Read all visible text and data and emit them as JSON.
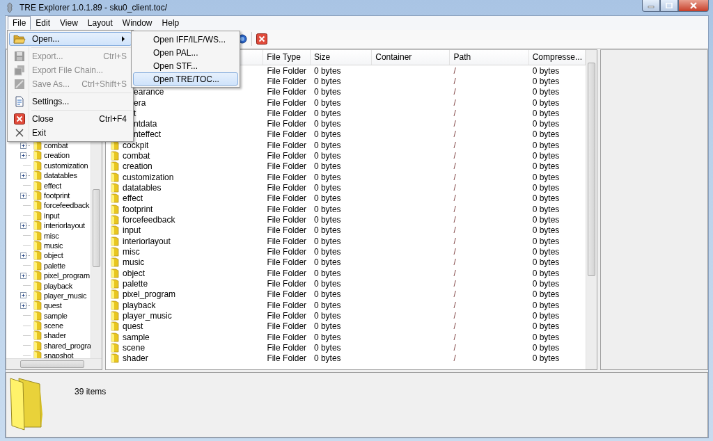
{
  "window": {
    "title": "TRE Explorer 1.0.1.89 - sku0_client.toc/"
  },
  "menubar": [
    {
      "label": "File",
      "selected": true
    },
    {
      "label": "Edit",
      "selected": false
    },
    {
      "label": "View",
      "selected": false
    },
    {
      "label": "Layout",
      "selected": false
    },
    {
      "label": "Window",
      "selected": false
    },
    {
      "label": "Help",
      "selected": false
    }
  ],
  "file_menu": [
    {
      "kind": "item",
      "label": "Open...",
      "selected": true,
      "disabled": false,
      "submenu": true
    },
    {
      "kind": "separator"
    },
    {
      "kind": "item",
      "label": "Export...",
      "shortcut": "Ctrl+S",
      "selected": false,
      "disabled": true
    },
    {
      "kind": "item",
      "label": "Export File Chain...",
      "selected": false,
      "disabled": true
    },
    {
      "kind": "item",
      "label": "Save As...",
      "shortcut": "Ctrl+Shift+S",
      "selected": false,
      "disabled": true
    },
    {
      "kind": "separator"
    },
    {
      "kind": "item",
      "label": "Settings...",
      "selected": false,
      "disabled": false
    },
    {
      "kind": "separator"
    },
    {
      "kind": "item",
      "label": "Close",
      "shortcut": "Ctrl+F4",
      "selected": false,
      "disabled": false
    },
    {
      "kind": "item",
      "label": "Exit",
      "selected": false,
      "disabled": false
    }
  ],
  "open_submenu": [
    {
      "label": "Open IFF/ILF/WS...",
      "selected": false
    },
    {
      "label": "Open PAL...",
      "selected": false
    },
    {
      "label": "Open STF...",
      "selected": false
    },
    {
      "label": "Open TRE/TOC...",
      "selected": true
    }
  ],
  "tree": [
    {
      "name": "combat",
      "expandable": true
    },
    {
      "name": "creation",
      "expandable": true
    },
    {
      "name": "customization",
      "expandable": false
    },
    {
      "name": "datatables",
      "expandable": true
    },
    {
      "name": "effect",
      "expandable": false
    },
    {
      "name": "footprint",
      "expandable": true
    },
    {
      "name": "forcefeedback",
      "expandable": false
    },
    {
      "name": "input",
      "expandable": false
    },
    {
      "name": "interiorlayout",
      "expandable": true
    },
    {
      "name": "misc",
      "expandable": false
    },
    {
      "name": "music",
      "expandable": false
    },
    {
      "name": "object",
      "expandable": true
    },
    {
      "name": "palette",
      "expandable": false
    },
    {
      "name": "pixel_program",
      "expandable": true
    },
    {
      "name": "playback",
      "expandable": false
    },
    {
      "name": "player_music",
      "expandable": true
    },
    {
      "name": "quest",
      "expandable": true
    },
    {
      "name": "sample",
      "expandable": false
    },
    {
      "name": "scene",
      "expandable": false
    },
    {
      "name": "shader",
      "expandable": false
    },
    {
      "name": "shared_progra",
      "expandable": false
    },
    {
      "name": "snapshot",
      "expandable": false
    }
  ],
  "table": {
    "columns": [
      "File Type",
      "Size",
      "Container",
      "Path",
      "Compresse..."
    ],
    "rows": [
      {
        "file_type": "File Folder",
        "size": "0 bytes",
        "path": "/",
        "compressed": "0 bytes"
      },
      {
        "file_type": "File Folder",
        "size": "0 bytes",
        "path": "/",
        "compressed": "0 bytes"
      },
      {
        "name": "earance",
        "partly_covered": true,
        "file_type": "File Folder",
        "size": "0 bytes",
        "path": "/",
        "compressed": "0 bytes"
      },
      {
        "name": "era",
        "partly_covered": true,
        "file_type": "File Folder",
        "size": "0 bytes",
        "path": "/",
        "compressed": "0 bytes"
      },
      {
        "name": "t",
        "partly_covered": true,
        "file_type": "File Folder",
        "size": "0 bytes",
        "path": "/",
        "compressed": "0 bytes"
      },
      {
        "name": "ntdata",
        "partly_covered": true,
        "file_type": "File Folder",
        "size": "0 bytes",
        "path": "/",
        "compressed": "0 bytes"
      },
      {
        "name": "nteffect",
        "partly_covered": true,
        "file_type": "File Folder",
        "size": "0 bytes",
        "path": "/",
        "compressed": "0 bytes"
      },
      {
        "name": "cockpit",
        "file_type": "File Folder",
        "size": "0 bytes",
        "path": "/",
        "compressed": "0 bytes"
      },
      {
        "name": "combat",
        "file_type": "File Folder",
        "size": "0 bytes",
        "path": "/",
        "compressed": "0 bytes"
      },
      {
        "name": "creation",
        "file_type": "File Folder",
        "size": "0 bytes",
        "path": "/",
        "compressed": "0 bytes"
      },
      {
        "name": "customization",
        "file_type": "File Folder",
        "size": "0 bytes",
        "path": "/",
        "compressed": "0 bytes"
      },
      {
        "name": "datatables",
        "file_type": "File Folder",
        "size": "0 bytes",
        "path": "/",
        "compressed": "0 bytes"
      },
      {
        "name": "effect",
        "file_type": "File Folder",
        "size": "0 bytes",
        "path": "/",
        "compressed": "0 bytes"
      },
      {
        "name": "footprint",
        "file_type": "File Folder",
        "size": "0 bytes",
        "path": "/",
        "compressed": "0 bytes"
      },
      {
        "name": "forcefeedback",
        "file_type": "File Folder",
        "size": "0 bytes",
        "path": "/",
        "compressed": "0 bytes"
      },
      {
        "name": "input",
        "file_type": "File Folder",
        "size": "0 bytes",
        "path": "/",
        "compressed": "0 bytes"
      },
      {
        "name": "interiorlayout",
        "file_type": "File Folder",
        "size": "0 bytes",
        "path": "/",
        "compressed": "0 bytes"
      },
      {
        "name": "misc",
        "file_type": "File Folder",
        "size": "0 bytes",
        "path": "/",
        "compressed": "0 bytes"
      },
      {
        "name": "music",
        "file_type": "File Folder",
        "size": "0 bytes",
        "path": "/",
        "compressed": "0 bytes"
      },
      {
        "name": "object",
        "file_type": "File Folder",
        "size": "0 bytes",
        "path": "/",
        "compressed": "0 bytes"
      },
      {
        "name": "palette",
        "file_type": "File Folder",
        "size": "0 bytes",
        "path": "/",
        "compressed": "0 bytes"
      },
      {
        "name": "pixel_program",
        "file_type": "File Folder",
        "size": "0 bytes",
        "path": "/",
        "compressed": "0 bytes"
      },
      {
        "name": "playback",
        "file_type": "File Folder",
        "size": "0 bytes",
        "path": "/",
        "compressed": "0 bytes"
      },
      {
        "name": "player_music",
        "file_type": "File Folder",
        "size": "0 bytes",
        "path": "/",
        "compressed": "0 bytes"
      },
      {
        "name": "quest",
        "file_type": "File Folder",
        "size": "0 bytes",
        "path": "/",
        "compressed": "0 bytes"
      },
      {
        "name": "sample",
        "file_type": "File Folder",
        "size": "0 bytes",
        "path": "/",
        "compressed": "0 bytes"
      },
      {
        "name": "scene",
        "file_type": "File Folder",
        "size": "0 bytes",
        "path": "/",
        "compressed": "0 bytes"
      },
      {
        "name": "shader",
        "file_type": "File Folder",
        "size": "0 bytes",
        "path": "/",
        "compressed": "0 bytes"
      }
    ]
  },
  "status": {
    "count": "39 items"
  }
}
